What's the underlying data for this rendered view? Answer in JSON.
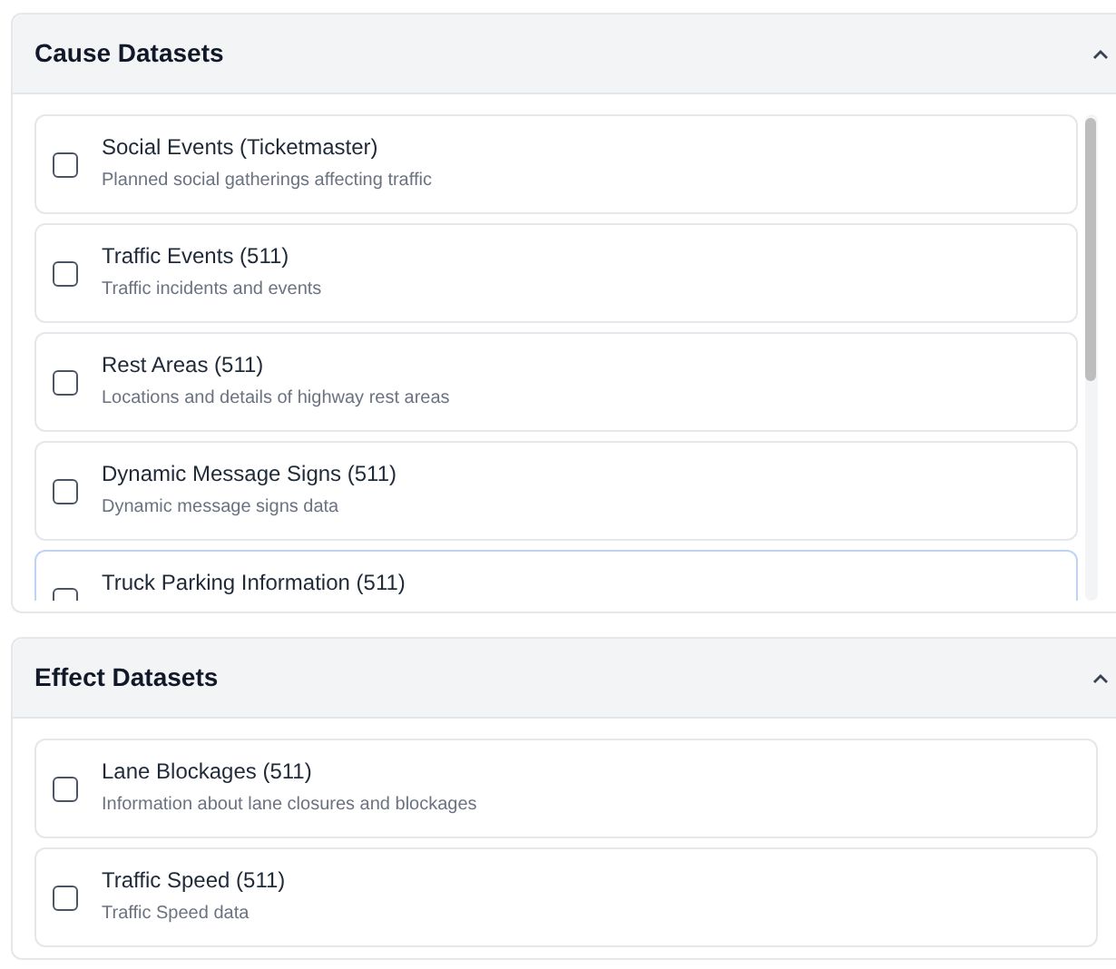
{
  "panels": [
    {
      "title": "Cause Datasets",
      "expanded": true,
      "scrollable": true,
      "items": [
        {
          "title": "Social Events (Ticketmaster)",
          "description": "Planned social gatherings affecting traffic",
          "checked": false,
          "focused": false
        },
        {
          "title": "Traffic Events (511)",
          "description": "Traffic incidents and events",
          "checked": false,
          "focused": false
        },
        {
          "title": "Rest Areas (511)",
          "description": "Locations and details of highway rest areas",
          "checked": false,
          "focused": false
        },
        {
          "title": "Dynamic Message Signs (511)",
          "description": "Dynamic message signs data",
          "checked": false,
          "focused": false
        },
        {
          "title": "Truck Parking Information (511)",
          "checked": false,
          "focused": true
        }
      ]
    },
    {
      "title": "Effect Datasets",
      "expanded": true,
      "scrollable": false,
      "items": [
        {
          "title": "Lane Blockages (511)",
          "description": "Information about lane closures and blockages",
          "checked": false,
          "focused": false
        },
        {
          "title": "Traffic Speed (511)",
          "description": "Traffic Speed data",
          "checked": false,
          "focused": false
        }
      ]
    }
  ]
}
